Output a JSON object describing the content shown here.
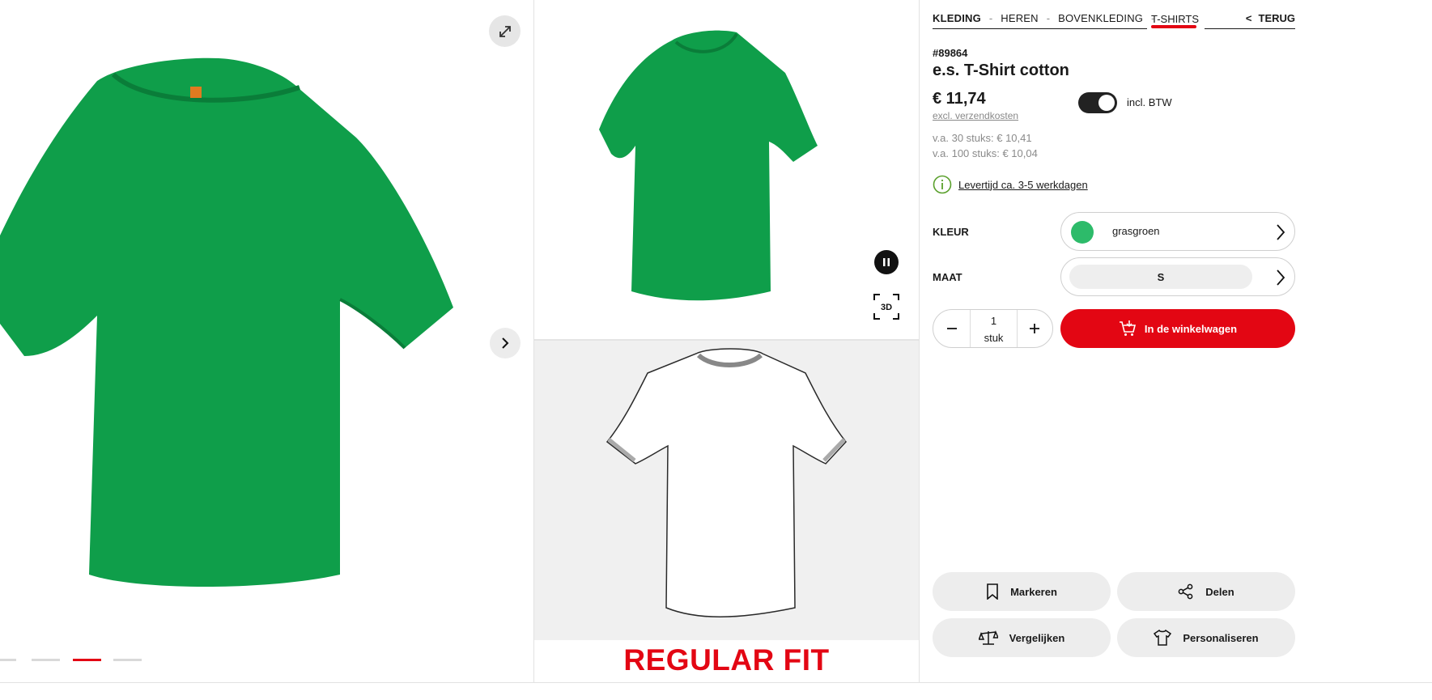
{
  "gallery": {
    "fit_label": "REGULAR FIT",
    "dots": 4,
    "active_dot": 3
  },
  "breadcrumb": {
    "items": [
      "KLEDING",
      "HEREN",
      "BOVENKLEDING"
    ],
    "separator": "-",
    "current": "T-SHIRTS",
    "back_label": "TERUG",
    "back_chevron": "<"
  },
  "product": {
    "sku": "#89864",
    "title": "e.s. T-Shirt cotton",
    "price": "€ 11,74",
    "shipping": "excl. verzendkosten",
    "vat_toggle_label": "incl. BTW",
    "vat_toggle_on": true,
    "tier_prices": [
      "v.a. 30 stuks: € 10,41",
      "v.a. 100 stuks: € 10,04"
    ],
    "delivery": "Levertijd ca. 3-5 werkdagen"
  },
  "options": {
    "color_label": "KLEUR",
    "color_value": "grasgroen",
    "color_hex": "#2dbb6a",
    "size_label": "MAAT",
    "size_value": "S"
  },
  "cart": {
    "quantity": "1",
    "unit": "stuk",
    "add_label": "In de winkelwagen"
  },
  "actions": {
    "mark": "Markeren",
    "share": "Delen",
    "compare": "Vergelijken",
    "personalize": "Personaliseren"
  },
  "colors": {
    "accent": "#e30613",
    "shirt": "#0f9e4a"
  },
  "icons": {
    "expand": "expand-icon",
    "next": "chevron-right-icon",
    "pause": "pause-icon",
    "view3d": "3d-view-icon",
    "info": "info-icon",
    "cart": "cart-icon",
    "bookmark": "bookmark-icon",
    "share": "share-icon",
    "compare": "scale-icon",
    "personalize": "tshirt-icon"
  }
}
